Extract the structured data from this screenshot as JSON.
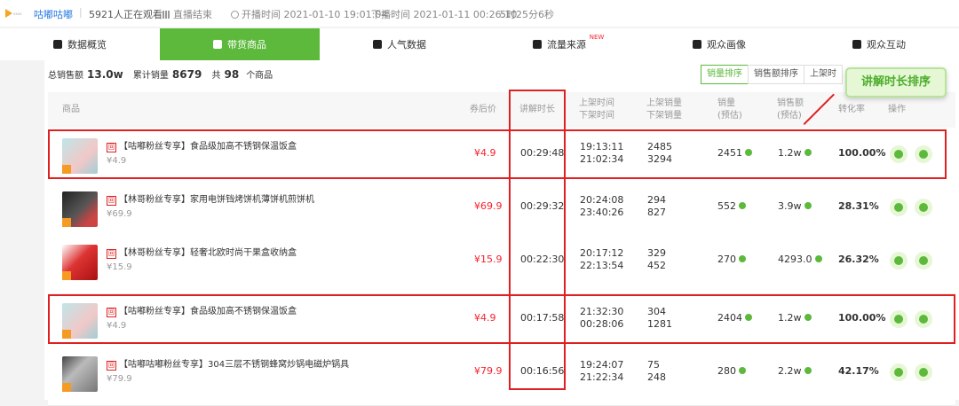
{
  "topbar": {
    "logo_text": "xxxx",
    "name": "咕嘟咕嘟",
    "separator": "|",
    "watching": "5921人正在观看",
    "status": "直播结束",
    "start_time": "开播时间 2021-01-10 19:01:04",
    "end_time": "下播时间 2021-01-11 00:26:10",
    "duration": "5时25分6秒"
  },
  "tabs": [
    {
      "label": "数据概览",
      "icon": "bar-chart-icon"
    },
    {
      "label": "带货商品",
      "icon": "shopping-bag-icon",
      "active": true
    },
    {
      "label": "人气数据",
      "icon": "fire-icon"
    },
    {
      "label": "流量来源",
      "icon": "flow-icon",
      "badge": "NEW"
    },
    {
      "label": "观众画像",
      "icon": "portrait-icon"
    },
    {
      "label": "观众互动",
      "icon": "interaction-icon"
    }
  ],
  "summary": {
    "sales_label": "总销售额",
    "sales_value": "13.0w",
    "volume_label": "累计销量",
    "volume_value": "8679",
    "count_prefix": "共",
    "count_value": "98",
    "count_suffix": "个商品"
  },
  "sort": {
    "buttons": [
      "销量排序",
      "销售额排序",
      "上架时"
    ],
    "callout": "讲解时长排序"
  },
  "table": {
    "headers": {
      "product": "商品",
      "price": "券后价",
      "explain": "讲解时长",
      "time_on": "上架时间",
      "time_off": "下架时间",
      "vol_on": "上架销量",
      "vol_off": "下架销量",
      "sales": "销量",
      "sales_note": "(预估)",
      "amount": "销售额",
      "amount_note": "(预估)",
      "conversion": "转化率",
      "ops": "操作"
    },
    "rows": [
      {
        "badge": "回",
        "title": "【咕嘟粉丝专享】食品级加高不锈钢保温饭盒",
        "sub_price": "¥4.9",
        "price": "¥4.9",
        "explain": "00:29:48",
        "on": "19:13:11",
        "off": "21:02:34",
        "vol_on": "2485",
        "vol_off": "3294",
        "sales": "2451",
        "amount": "1.2w",
        "conv": "100.00%"
      },
      {
        "badge": "回",
        "title": "【林哥粉丝专享】家用电饼铛烤饼机薄饼机煎饼机",
        "sub_price": "¥69.9",
        "price": "¥69.9",
        "explain": "00:29:32",
        "on": "20:24:08",
        "off": "23:40:26",
        "vol_on": "294",
        "vol_off": "827",
        "sales": "552",
        "amount": "3.9w",
        "conv": "28.31%"
      },
      {
        "badge": "回",
        "title": "【林哥粉丝专享】轻奢北欧时尚干果盒收纳盒",
        "sub_price": "¥15.9",
        "price": "¥15.9",
        "explain": "00:22:30",
        "on": "20:17:12",
        "off": "22:13:54",
        "vol_on": "329",
        "vol_off": "452",
        "sales": "270",
        "amount": "4293.0",
        "conv": "26.32%"
      },
      {
        "badge": "回",
        "title": "【咕嘟粉丝专享】食品级加高不锈钢保温饭盒",
        "sub_price": "¥4.9",
        "price": "¥4.9",
        "explain": "00:17:58",
        "on": "21:32:30",
        "off": "00:28:06",
        "vol_on": "304",
        "vol_off": "1281",
        "sales": "2404",
        "amount": "1.2w",
        "conv": "100.00%"
      },
      {
        "badge": "回",
        "title": "【咕嘟咕嘟粉丝专享】304三层不锈钢蜂窝炒锅电磁炉锅具",
        "sub_price": "¥79.9",
        "price": "¥79.9",
        "explain": "00:16:56",
        "on": "19:24:07",
        "off": "21:22:34",
        "vol_on": "75",
        "vol_off": "248",
        "sales": "280",
        "amount": "2.2w",
        "conv": "42.17%"
      }
    ]
  },
  "colors": {
    "accent": "#5cb93b",
    "highlight": "#e02020",
    "price": "#f5222d"
  }
}
